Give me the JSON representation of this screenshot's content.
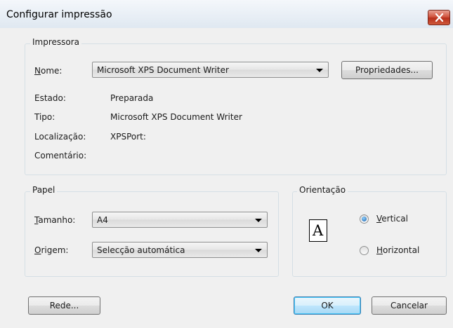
{
  "window": {
    "title": "Configurar impressão"
  },
  "printer": {
    "group_label": "Impressora",
    "name_label": "Nome:",
    "name_value": "Microsoft XPS Document Writer",
    "properties_button": "Propriedades...",
    "status_label": "Estado:",
    "status_value": "Preparada",
    "type_label": "Tipo:",
    "type_value": "Microsoft XPS Document Writer",
    "location_label": "Localização:",
    "location_value": "XPSPort:",
    "comment_label": "Comentário:",
    "comment_value": ""
  },
  "paper": {
    "group_label": "Papel",
    "size_label": "Tamanho:",
    "size_value": "A4",
    "source_label": "Origem:",
    "source_value": "Selecção automática"
  },
  "orientation": {
    "group_label": "Orientação",
    "icon_letter": "A",
    "options": [
      {
        "label": "Vertical",
        "selected": true
      },
      {
        "label": "Horizontal",
        "selected": false
      }
    ]
  },
  "buttons": {
    "network": "Rede...",
    "ok": "OK",
    "cancel": "Cancelar"
  }
}
